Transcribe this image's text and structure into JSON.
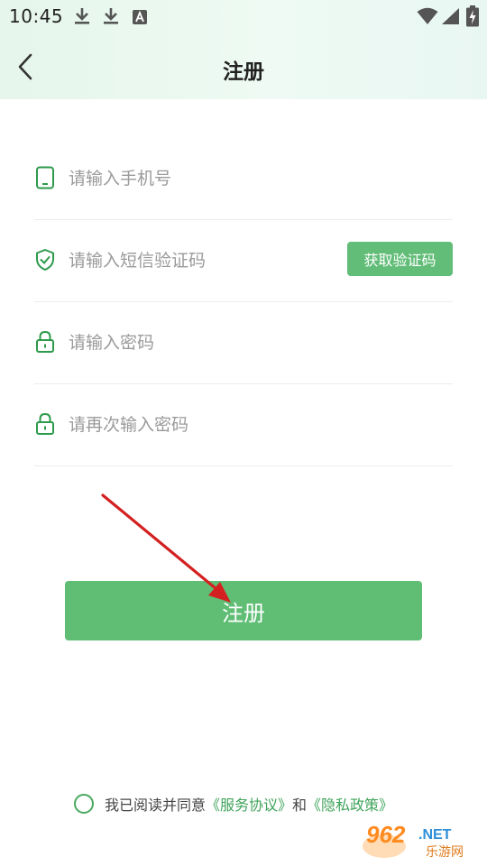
{
  "status_bar": {
    "time": "10:45"
  },
  "header": {
    "title": "注册"
  },
  "form": {
    "phone_placeholder": "请输入手机号",
    "sms_placeholder": "请输入短信验证码",
    "get_code_label": "获取验证码",
    "password_placeholder": "请输入密码",
    "confirm_placeholder": "请再次输入密码"
  },
  "register_label": "注册",
  "agreement": {
    "prefix": "我已阅读并同意",
    "terms": "《服务协议》",
    "and": "和",
    "privacy": "《隐私政策》"
  },
  "watermark": {
    "logo": "962.NET",
    "sub": "乐游网"
  },
  "colors": {
    "accent": "#5fbd74",
    "link": "#3fa35a",
    "annotation_arrow": "#d42020"
  }
}
